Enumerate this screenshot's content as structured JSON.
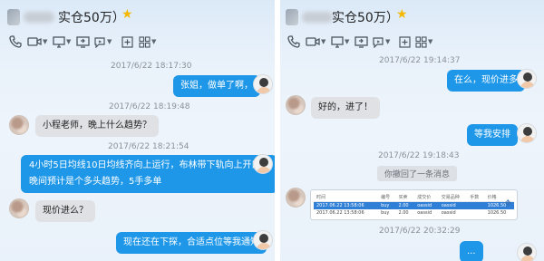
{
  "left": {
    "title": "实仓50万）",
    "messages": [
      {
        "time": "2017/6/22 18:17:30"
      },
      {
        "text": "张姐，做单了啊，"
      },
      {
        "time": "2017/6/22 18:19:48"
      },
      {
        "text": "小程老师，晚上什么趋势？"
      },
      {
        "time": "2017/6/22 18:21:54"
      },
      {
        "lines": [
          "4小时5日均线10日均线齐向上运行，布林带下轨向上开口，",
          "晚间预计是个多头趋势，5手多单"
        ]
      },
      {
        "text": "现价进么？"
      },
      {
        "text": "现在还在下探，合适点位等我通知"
      }
    ]
  },
  "right": {
    "title": "实仓50万）",
    "messages": [
      {
        "time": "2017/6/22 19:14:37"
      },
      {
        "text": "在么，现价进多"
      },
      {
        "text": "好的，进了！"
      },
      {
        "text": "等我安排"
      },
      {
        "time": "2017/6/22 19:18:43"
      },
      {
        "recall": "你撤回了一条消息"
      },
      {
        "file_table": {
          "headers": [
            "时间",
            "编号",
            "买卖",
            "成交价",
            "交易品种",
            "手数",
            "价格"
          ],
          "rows": [
            [
              "2017.06.22 13:58:06",
              "buy",
              "2.00",
              "oassid",
              "oassid",
              "",
              "1026.50"
            ],
            [
              "2017.06.22 13:58:06",
              "buy",
              "2.00",
              "oassid",
              "oassid",
              "",
              "1026.50"
            ]
          ]
        }
      },
      {
        "time": "2017/6/22 20:32:29"
      },
      {
        "text": "..."
      }
    ]
  },
  "icons": [
    "phone-icon",
    "video-icon",
    "screen-share-icon",
    "remote-assist-icon",
    "add-icon",
    "apps-icon"
  ],
  "colors": {
    "bubble_blue": "#1e97e8",
    "bubble_gray": "#dfe1e4",
    "star": "#f5b800"
  }
}
